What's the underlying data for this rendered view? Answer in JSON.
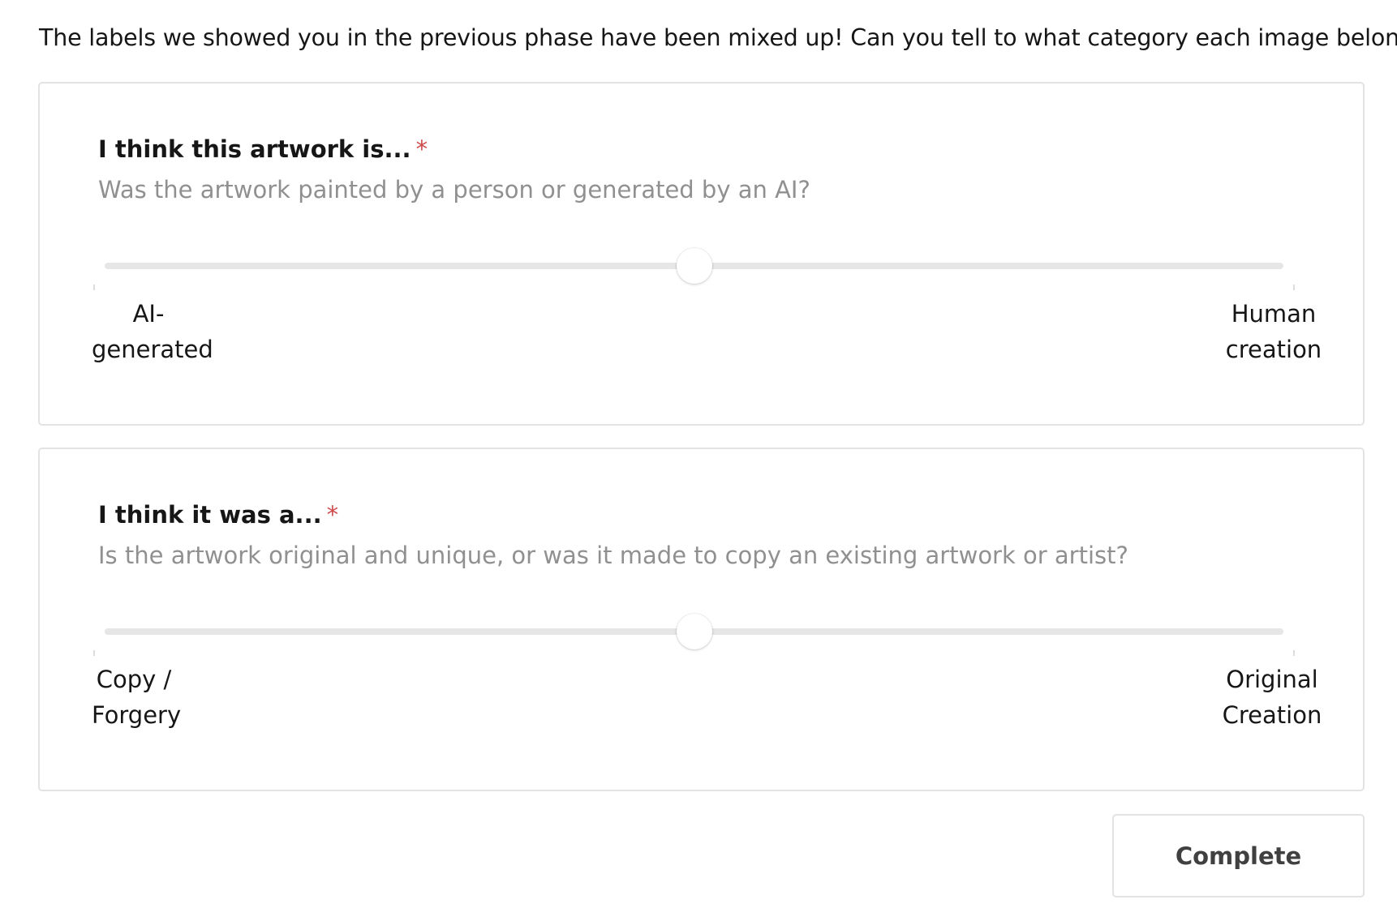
{
  "intro_text": "The labels we showed you in the previous phase have been mixed up! Can you tell to what category each image belongs?",
  "questions": [
    {
      "title": "I think this artwork is...",
      "required_mark": "*",
      "description": "Was the artwork painted by a person or generated by an AI?",
      "slider_value": 0.5,
      "min_label": [
        "AI-",
        "generated"
      ],
      "max_label": [
        "Human",
        "creation"
      ]
    },
    {
      "title": "I think it was a...",
      "required_mark": "*",
      "description": "Is the artwork original and unique, or was it made to copy an existing artwork or artist?",
      "slider_value": 0.5,
      "min_label": [
        "Copy /",
        "Forgery"
      ],
      "max_label": [
        "Original",
        "Creation"
      ]
    }
  ],
  "complete_button": "Complete",
  "colors": {
    "required": "#cd4a4a",
    "description": "#909090",
    "track": "#e6e6e6",
    "border": "#e3e3e3"
  }
}
